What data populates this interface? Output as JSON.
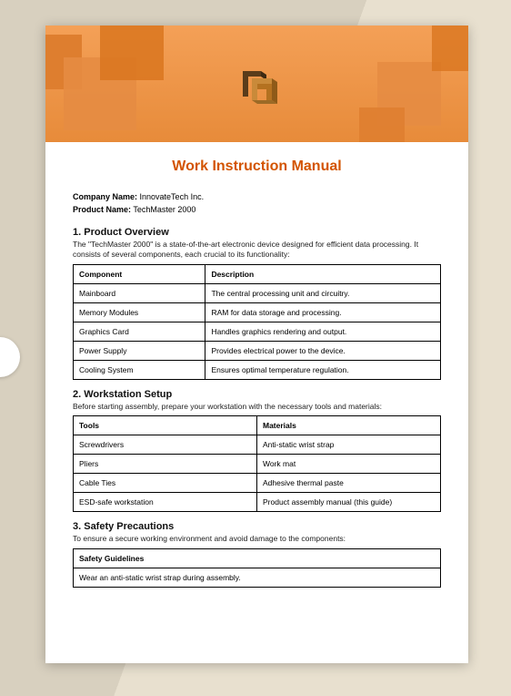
{
  "title": "Work Instruction Manual",
  "meta": {
    "company_label": "Company Name:",
    "company_value": "InnovateTech Inc.",
    "product_label": "Product Name:",
    "product_value": "TechMaster 2000"
  },
  "section1": {
    "heading": "1. Product Overview",
    "intro": "The \"TechMaster 2000\" is a state-of-the-art electronic device designed for efficient data processing. It consists of several components, each crucial to its functionality:",
    "col1": "Component",
    "col2": "Description",
    "rows": [
      {
        "c": "Mainboard",
        "d": "The central processing unit and circuitry."
      },
      {
        "c": "Memory Modules",
        "d": "RAM for data storage and processing."
      },
      {
        "c": "Graphics Card",
        "d": "Handles graphics rendering and output."
      },
      {
        "c": "Power Supply",
        "d": "Provides electrical power to the device."
      },
      {
        "c": "Cooling System",
        "d": "Ensures optimal temperature regulation."
      }
    ]
  },
  "section2": {
    "heading": "2. Workstation Setup",
    "intro": "Before starting assembly, prepare your workstation with the necessary tools and materials:",
    "col1": "Tools",
    "col2": "Materials",
    "rows": [
      {
        "t": "Screwdrivers",
        "m": "Anti-static wrist strap"
      },
      {
        "t": "Pliers",
        "m": "Work mat"
      },
      {
        "t": "Cable Ties",
        "m": "Adhesive thermal paste"
      },
      {
        "t": "ESD-safe workstation",
        "m": "Product assembly manual (this guide)"
      }
    ]
  },
  "section3": {
    "heading": "3. Safety Precautions",
    "intro": "To ensure a secure working environment and avoid damage to the components:",
    "col1": "Safety Guidelines",
    "rows": [
      {
        "g": "Wear an anti-static wrist strap during assembly."
      }
    ]
  }
}
